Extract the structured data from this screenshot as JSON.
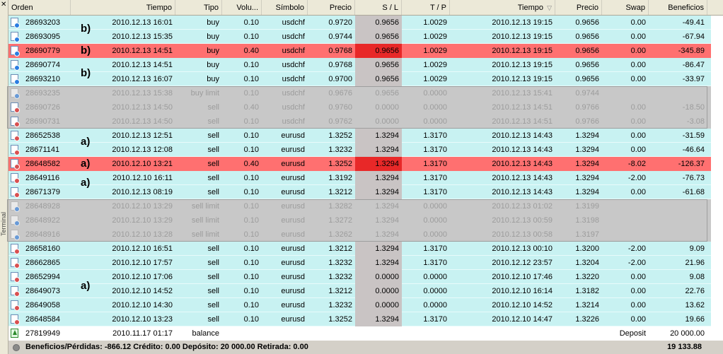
{
  "columns": {
    "order": "Orden",
    "time": "Tiempo",
    "type": "Tipo",
    "volume": "Volu...",
    "symbol": "Símbolo",
    "price": "Precio",
    "sl": "S / L",
    "tp": "T / P",
    "close_time": "Tiempo",
    "close_price": "Precio",
    "swap": "Swap",
    "profit": "Beneficios"
  },
  "sort_indicator": "▽",
  "colors": {
    "normal_row": "#c8f2f2",
    "highlight_row": "#ff7070",
    "pending_row": "#c8c8c8",
    "sl_cell": "#c9c4c4",
    "sl_cell_highlight": "#e82828"
  },
  "rows": [
    {
      "kind": "normal",
      "icon": "buy",
      "order": "28693203",
      "time": "2010.12.13 16:01",
      "type": "buy",
      "volume": "0.10",
      "symbol": "usdchf",
      "price": "0.9720",
      "sl": "0.9656",
      "tp": "1.0029",
      "close_time": "2010.12.13 19:15",
      "close_price": "0.9656",
      "swap": "0.00",
      "profit": "-49.41"
    },
    {
      "kind": "normal",
      "icon": "buy",
      "order": "28693095",
      "time": "2010.12.13 15:35",
      "type": "buy",
      "volume": "0.10",
      "symbol": "usdchf",
      "price": "0.9744",
      "sl": "0.9656",
      "tp": "1.0029",
      "close_time": "2010.12.13 19:15",
      "close_price": "0.9656",
      "swap": "0.00",
      "profit": "-67.94"
    },
    {
      "kind": "hl",
      "icon": "buy",
      "order": "28690779",
      "time": "2010.12.13 14:51",
      "type": "buy",
      "volume": "0.40",
      "symbol": "usdchf",
      "price": "0.9768",
      "sl": "0.9656",
      "tp": "1.0029",
      "close_time": "2010.12.13 19:15",
      "close_price": "0.9656",
      "swap": "0.00",
      "profit": "-345.89"
    },
    {
      "kind": "normal",
      "icon": "buy",
      "order": "28690774",
      "time": "2010.12.13 14:51",
      "type": "buy",
      "volume": "0.10",
      "symbol": "usdchf",
      "price": "0.9768",
      "sl": "0.9656",
      "tp": "1.0029",
      "close_time": "2010.12.13 19:15",
      "close_price": "0.9656",
      "swap": "0.00",
      "profit": "-86.47"
    },
    {
      "kind": "normal",
      "icon": "buy",
      "order": "28693210",
      "time": "2010.12.13 16:07",
      "type": "buy",
      "volume": "0.10",
      "symbol": "usdchf",
      "price": "0.9700",
      "sl": "0.9656",
      "tp": "1.0029",
      "close_time": "2010.12.13 19:15",
      "close_price": "0.9656",
      "swap": "0.00",
      "profit": "-33.97"
    },
    {
      "kind": "pending",
      "icon": "buy-limit",
      "order": "28693235",
      "time": "2010.12.13 15:38",
      "type": "buy limit",
      "volume": "0.10",
      "symbol": "usdchf",
      "price": "0.9676",
      "sl": "0.9656",
      "tp": "0.0000",
      "close_time": "2010.12.13 15:41",
      "close_price": "0.9744",
      "swap": "",
      "profit": ""
    },
    {
      "kind": "pending",
      "icon": "sell",
      "order": "28690726",
      "time": "2010.12.13 14:50",
      "type": "sell",
      "volume": "0.40",
      "symbol": "usdchf",
      "price": "0.9760",
      "sl": "0.0000",
      "tp": "0.0000",
      "close_time": "2010.12.13 14:51",
      "close_price": "0.9766",
      "swap": "0.00",
      "profit": "-18.50"
    },
    {
      "kind": "pending",
      "icon": "sell",
      "order": "28690731",
      "time": "2010.12.13 14:50",
      "type": "sell",
      "volume": "0.10",
      "symbol": "usdchf",
      "price": "0.9762",
      "sl": "0.0000",
      "tp": "0.0000",
      "close_time": "2010.12.13 14:51",
      "close_price": "0.9766",
      "swap": "0.00",
      "profit": "-3.08"
    },
    {
      "kind": "normal",
      "icon": "sell",
      "order": "28652538",
      "time": "2010.12.13 12:51",
      "type": "sell",
      "volume": "0.10",
      "symbol": "eurusd",
      "price": "1.3252",
      "sl": "1.3294",
      "tp": "1.3170",
      "close_time": "2010.12.13 14:43",
      "close_price": "1.3294",
      "swap": "0.00",
      "profit": "-31.59"
    },
    {
      "kind": "normal",
      "icon": "sell",
      "order": "28671141",
      "time": "2010.12.13 12:08",
      "type": "sell",
      "volume": "0.10",
      "symbol": "eurusd",
      "price": "1.3232",
      "sl": "1.3294",
      "tp": "1.3170",
      "close_time": "2010.12.13 14:43",
      "close_price": "1.3294",
      "swap": "0.00",
      "profit": "-46.64"
    },
    {
      "kind": "hl",
      "icon": "sell",
      "order": "28648582",
      "time": "2010.12.10 13:21",
      "type": "sell",
      "volume": "0.40",
      "symbol": "eurusd",
      "price": "1.3252",
      "sl": "1.3294",
      "tp": "1.3170",
      "close_time": "2010.12.13 14:43",
      "close_price": "1.3294",
      "swap": "-8.02",
      "profit": "-126.37"
    },
    {
      "kind": "normal",
      "icon": "sell",
      "order": "28649116",
      "time": "2010.12.10 16:11",
      "type": "sell",
      "volume": "0.10",
      "symbol": "eurusd",
      "price": "1.3192",
      "sl": "1.3294",
      "tp": "1.3170",
      "close_time": "2010.12.13 14:43",
      "close_price": "1.3294",
      "swap": "-2.00",
      "profit": "-76.73"
    },
    {
      "kind": "normal",
      "icon": "sell",
      "order": "28671379",
      "time": "2010.12.13 08:19",
      "type": "sell",
      "volume": "0.10",
      "symbol": "eurusd",
      "price": "1.3212",
      "sl": "1.3294",
      "tp": "1.3170",
      "close_time": "2010.12.13 14:43",
      "close_price": "1.3294",
      "swap": "0.00",
      "profit": "-61.68"
    },
    {
      "kind": "pending",
      "icon": "sell-limit",
      "order": "28648928",
      "time": "2010.12.10 13:29",
      "type": "sell limit",
      "volume": "0.10",
      "symbol": "eurusd",
      "price": "1.3282",
      "sl": "1.3294",
      "tp": "0.0000",
      "close_time": "2010.12.13 01:02",
      "close_price": "1.3199",
      "swap": "",
      "profit": ""
    },
    {
      "kind": "pending",
      "icon": "sell-limit",
      "order": "28648922",
      "time": "2010.12.10 13:29",
      "type": "sell limit",
      "volume": "0.10",
      "symbol": "eurusd",
      "price": "1.3272",
      "sl": "1.3294",
      "tp": "0.0000",
      "close_time": "2010.12.13 00:59",
      "close_price": "1.3198",
      "swap": "",
      "profit": ""
    },
    {
      "kind": "pending",
      "icon": "sell-limit",
      "order": "28648916",
      "time": "2010.12.10 13:28",
      "type": "sell limit",
      "volume": "0.10",
      "symbol": "eurusd",
      "price": "1.3262",
      "sl": "1.3294",
      "tp": "0.0000",
      "close_time": "2010.12.13 00:58",
      "close_price": "1.3197",
      "swap": "",
      "profit": ""
    },
    {
      "kind": "normal",
      "icon": "sell",
      "order": "28658160",
      "time": "2010.12.10 16:51",
      "type": "sell",
      "volume": "0.10",
      "symbol": "eurusd",
      "price": "1.3212",
      "sl": "1.3294",
      "tp": "1.3170",
      "close_time": "2010.12.13 00:10",
      "close_price": "1.3200",
      "swap": "-2.00",
      "profit": "9.09"
    },
    {
      "kind": "normal",
      "icon": "sell",
      "order": "28662865",
      "time": "2010.12.10 17:57",
      "type": "sell",
      "volume": "0.10",
      "symbol": "eurusd",
      "price": "1.3232",
      "sl": "1.3294",
      "tp": "1.3170",
      "close_time": "2010.12.12 23:57",
      "close_price": "1.3204",
      "swap": "-2.00",
      "profit": "21.96"
    },
    {
      "kind": "normal",
      "icon": "sell",
      "order": "28652994",
      "time": "2010.12.10 17:06",
      "type": "sell",
      "volume": "0.10",
      "symbol": "eurusd",
      "price": "1.3232",
      "sl": "0.0000",
      "tp": "0.0000",
      "close_time": "2010.12.10 17:46",
      "close_price": "1.3220",
      "swap": "0.00",
      "profit": "9.08"
    },
    {
      "kind": "normal",
      "icon": "sell",
      "order": "28649073",
      "time": "2010.12.10 14:52",
      "type": "sell",
      "volume": "0.10",
      "symbol": "eurusd",
      "price": "1.3212",
      "sl": "0.0000",
      "tp": "0.0000",
      "close_time": "2010.12.10 16:14",
      "close_price": "1.3182",
      "swap": "0.00",
      "profit": "22.76"
    },
    {
      "kind": "normal",
      "icon": "sell",
      "order": "28649058",
      "time": "2010.12.10 14:30",
      "type": "sell",
      "volume": "0.10",
      "symbol": "eurusd",
      "price": "1.3232",
      "sl": "0.0000",
      "tp": "0.0000",
      "close_time": "2010.12.10 14:52",
      "close_price": "1.3214",
      "swap": "0.00",
      "profit": "13.62"
    },
    {
      "kind": "normal",
      "icon": "sell",
      "order": "28648584",
      "time": "2010.12.10 13:23",
      "type": "sell",
      "volume": "0.10",
      "symbol": "eurusd",
      "price": "1.3252",
      "sl": "1.3294",
      "tp": "1.3170",
      "close_time": "2010.12.10 14:47",
      "close_price": "1.3226",
      "swap": "0.00",
      "profit": "19.66"
    },
    {
      "kind": "balance",
      "icon": "balance-icon",
      "order": "27819949",
      "time": "2010.11.17 01:17",
      "type": "balance",
      "volume": "",
      "symbol": "",
      "price": "",
      "sl": "",
      "tp": "",
      "close_time": "",
      "close_price": "",
      "swap": "Deposit",
      "profit": "20 000.00"
    }
  ],
  "annotations": [
    "b)",
    "b)",
    "b)",
    "a)",
    "a)",
    "a)",
    "a)"
  ],
  "status": {
    "summary": "Beneficios/Pérdidas: -866.12  Crédito: 0.00  Depósito: 20 000.00  Retirada: 0.00",
    "total": "19 133.88"
  },
  "left_tab": "Terminal"
}
